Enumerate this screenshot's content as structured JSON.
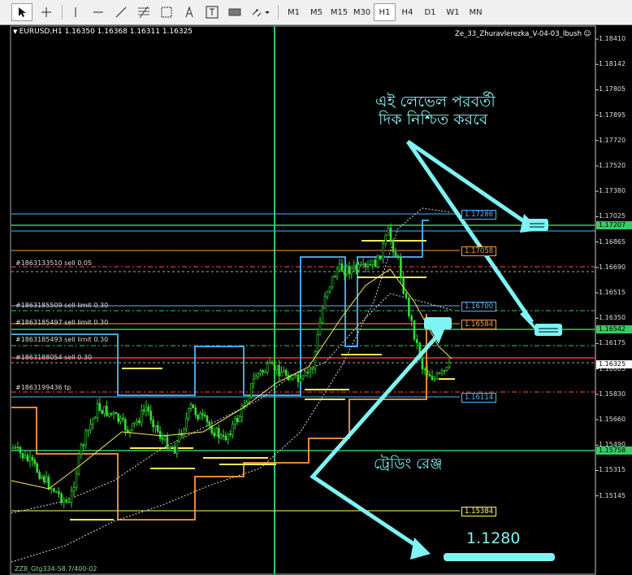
{
  "toolbar": {
    "timeframes": [
      "M1",
      "M5",
      "M15",
      "M30",
      "H1",
      "H4",
      "D1",
      "W1",
      "MN"
    ],
    "active_timeframe": "H1"
  },
  "chart": {
    "symbol_line": "EURUSD,H1  1.16350 1.16368 1.16311 1.16325",
    "indicator_name": "Ze_33_Zhuravlerezka_V-04-03_Ibush",
    "bottom_label": "ZZ8_Gtg334-58.7/400-02",
    "price_scale": [
      "1.18410",
      "1.18142",
      "1.17805",
      "1.17895",
      "1.17720",
      "1.17520",
      "1.17380",
      "1.17025",
      "1.16865",
      "1.16690",
      "1.16515",
      "1.16350",
      "1.16175",
      "1.16005",
      "1.15830",
      "1.15660",
      "1.15490",
      "1.15315",
      "1.15145"
    ],
    "price_highlights": [
      {
        "value": "1.17207",
        "bg": "#33cc66",
        "fg": "#000000"
      },
      {
        "value": "1.16542",
        "bg": "#33cc66",
        "fg": "#000000"
      },
      {
        "value": "1.16325",
        "bg": "#ffffff",
        "fg": "#000000"
      },
      {
        "value": "1.15758",
        "bg": "#33cc66",
        "fg": "#000000"
      }
    ],
    "level_tags": [
      {
        "value": "1.17286",
        "color": "#4db8ff"
      },
      {
        "value": "1.17058",
        "color": "#ff9a3c"
      },
      {
        "value": "1.16700",
        "color": "#4db8ff"
      },
      {
        "value": "1.16584",
        "color": "#ff9a3c"
      },
      {
        "value": "1.16114",
        "color": "#4db8ff"
      },
      {
        "value": "1.15384",
        "color": "#ffff66"
      }
    ],
    "order_labels": [
      "#1863133510 sell 0.05",
      "#1863185509 sell limit 0.30",
      "#1863185497 sell limit 0.30",
      "#1863185493 sell limit 0.30",
      "#1863188054 sell 0.30",
      "#1863199436 tp"
    ]
  },
  "annotations": {
    "confirm_text_line1": "এই লেভেল পরবর্তী",
    "confirm_text_line2": "দিক নিশ্চিত করবে",
    "range_text": "ট্রেডিং রেঞ্জ",
    "target_text": "1.1280",
    "color": "#7ff4f4"
  }
}
